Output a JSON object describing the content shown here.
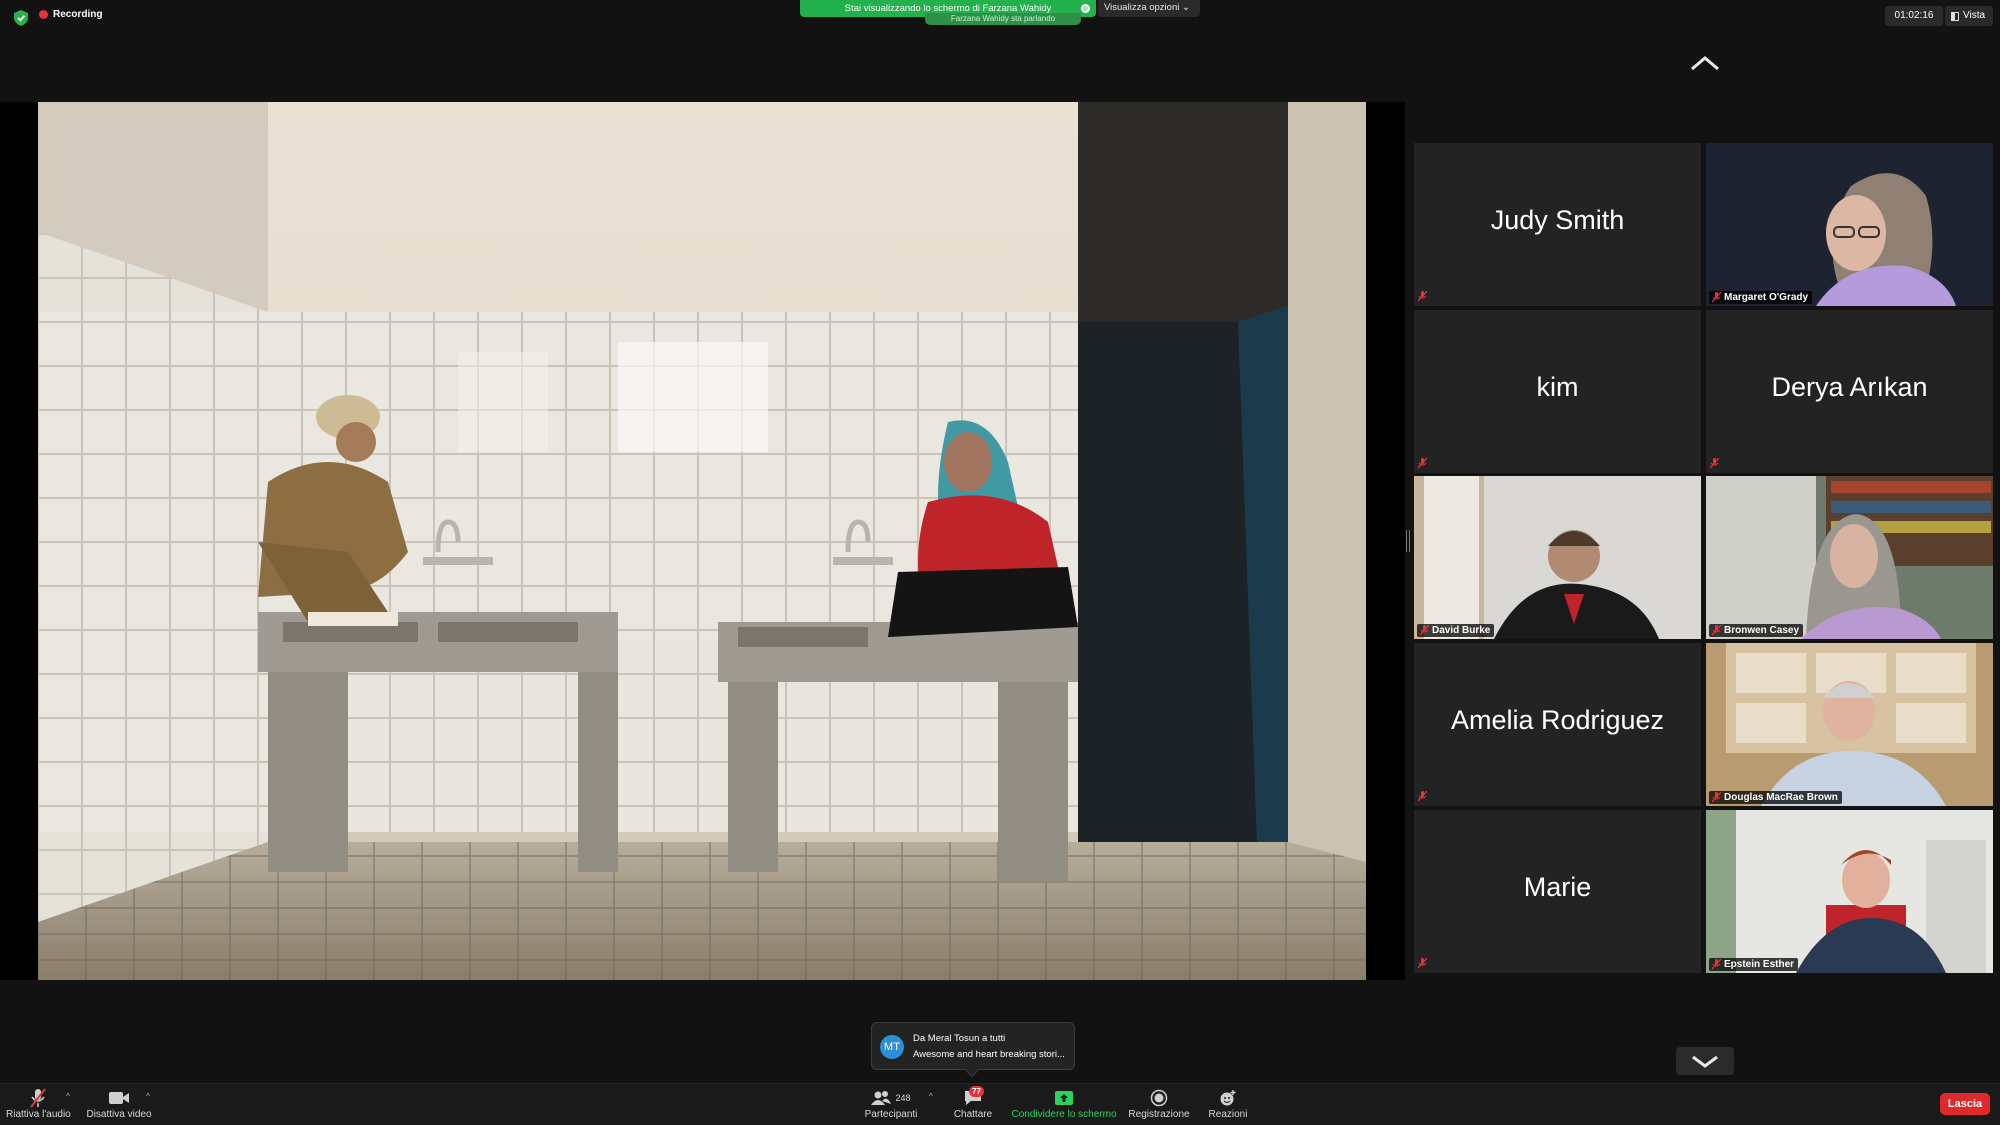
{
  "topbar": {
    "recording_label": "Recording",
    "share_banner": "Stai visualizzando lo schermo di Farzana Wahidy",
    "share_sub": "Farzana Wahidy sta parlando",
    "view_options": "Visualizza opzioni",
    "clock": "01:02:16",
    "view_label": "Vista"
  },
  "participants": [
    {
      "name": "Judy Smith",
      "video": false
    },
    {
      "name": "Margaret O'Grady",
      "video": true
    },
    {
      "name": "kim",
      "video": false
    },
    {
      "name": "Derya Arıkan",
      "video": false
    },
    {
      "name": "David Burke",
      "video": true
    },
    {
      "name": "Bronwen Casey",
      "video": true
    },
    {
      "name": "Amelia Rodriguez",
      "video": false
    },
    {
      "name": "Douglas MacRae Brown",
      "video": true
    },
    {
      "name": "Marie",
      "video": false
    },
    {
      "name": "Epstein Esther",
      "video": true
    }
  ],
  "chat_toast": {
    "initials": "MT",
    "from": "Da Meral Tosun a tutti",
    "message": "Awesome and heart breaking stori..."
  },
  "toolbar": {
    "unmute_label": "Riattiva l'audio",
    "stop_video_label": "Disattiva video",
    "participants_label": "Partecipanti",
    "participants_count": "248",
    "chat_label": "Chattare",
    "chat_badge": "77",
    "share_label": "Condividere lo schermo",
    "record_label": "Registrazione",
    "reactions_label": "Reazioni",
    "leave_label": "Lascia"
  },
  "colors": {
    "share_green": "#22b14c",
    "leave_red": "#e0282f",
    "recording_red": "#e5333b",
    "tile_background": "#232323"
  }
}
